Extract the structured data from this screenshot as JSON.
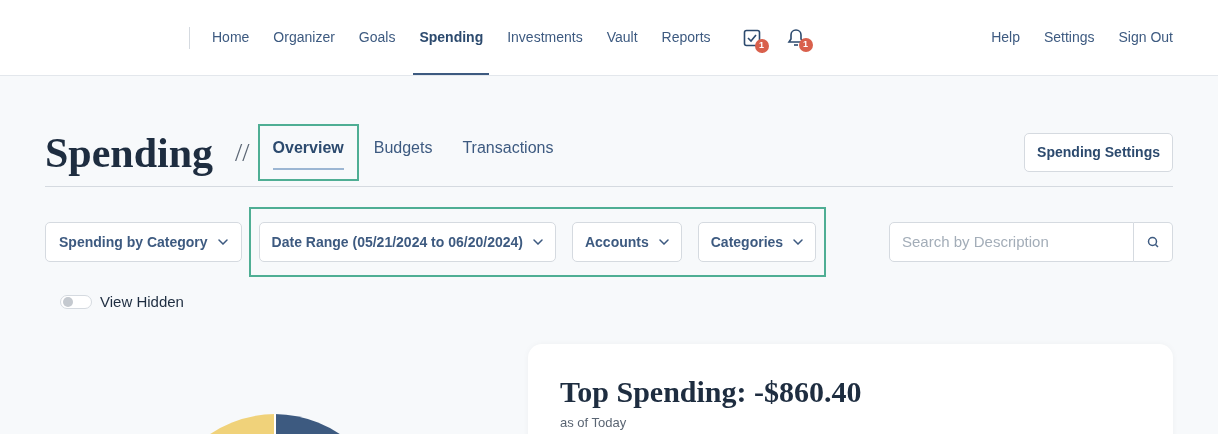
{
  "nav": {
    "items": [
      {
        "label": "Home",
        "selected": false
      },
      {
        "label": "Organizer",
        "selected": false
      },
      {
        "label": "Goals",
        "selected": false
      },
      {
        "label": "Spending",
        "selected": true
      },
      {
        "label": "Investments",
        "selected": false
      },
      {
        "label": "Vault",
        "selected": false
      },
      {
        "label": "Reports",
        "selected": false
      }
    ],
    "icons": [
      {
        "kind": "tasks",
        "badge": "1"
      },
      {
        "kind": "bell",
        "badge": "1"
      }
    ],
    "right_links": [
      "Help",
      "Settings",
      "Sign Out"
    ]
  },
  "page": {
    "title": "Spending",
    "separator": "//",
    "tabs": [
      {
        "label": "Overview",
        "selected": true,
        "highlighted": true
      },
      {
        "label": "Budgets",
        "selected": false,
        "highlighted": false
      },
      {
        "label": "Transactions",
        "selected": false,
        "highlighted": false
      }
    ],
    "settings_button": "Spending Settings"
  },
  "filters": {
    "view": "Spending by Category",
    "highlighted": true,
    "dropdowns": [
      "Date Range (05/21/2024 to 06/20/2024)",
      "Accounts",
      "Categories"
    ],
    "search": {
      "placeholder": "Search by Description"
    }
  },
  "view_hidden": {
    "label": "View Hidden",
    "on": false
  },
  "card": {
    "title": "Top Spending: -$860.40",
    "subtitle": "as of Today"
  }
}
